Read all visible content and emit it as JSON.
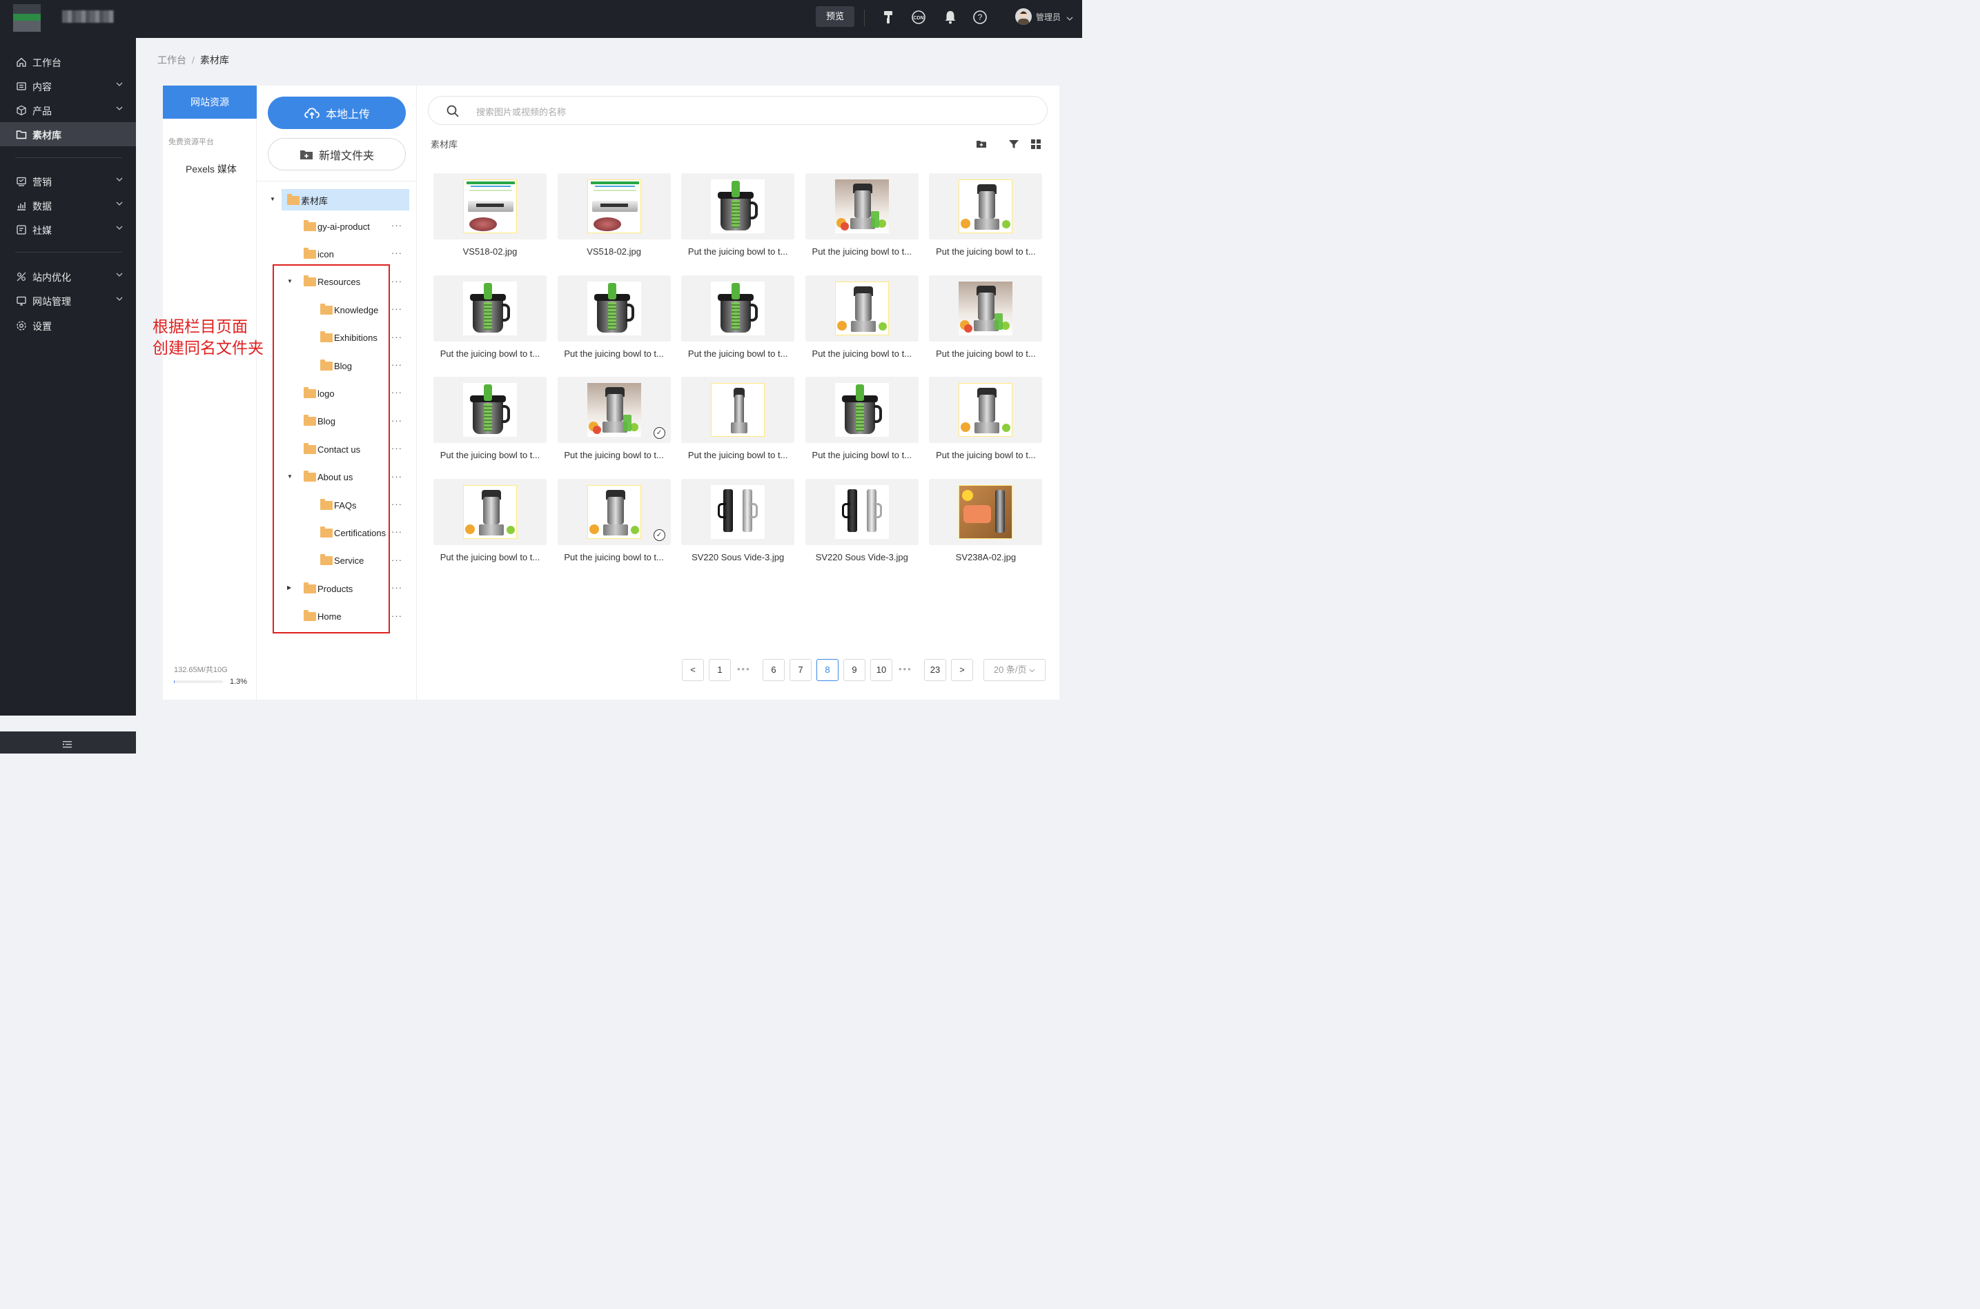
{
  "topbar": {
    "preview_label": "预览",
    "cdn_label": "CDN",
    "user_name": "管理员"
  },
  "sidebar": {
    "items": [
      {
        "label": "工作台",
        "icon": "home-icon",
        "has_children": false,
        "active": false
      },
      {
        "label": "内容",
        "icon": "content-icon",
        "has_children": true,
        "active": false
      },
      {
        "label": "产品",
        "icon": "product-icon",
        "has_children": true,
        "active": false
      },
      {
        "label": "素材库",
        "icon": "folder-icon",
        "has_children": false,
        "active": true
      },
      {
        "label": "营销",
        "icon": "marketing-icon",
        "has_children": true,
        "active": false
      },
      {
        "label": "数据",
        "icon": "data-icon",
        "has_children": true,
        "active": false
      },
      {
        "label": "社媒",
        "icon": "social-icon",
        "has_children": true,
        "active": false
      },
      {
        "label": "站内优化",
        "icon": "seo-icon",
        "has_children": true,
        "active": false
      },
      {
        "label": "网站管理",
        "icon": "website-icon",
        "has_children": true,
        "active": false
      },
      {
        "label": "设置",
        "icon": "settings-icon",
        "has_children": false,
        "active": false
      }
    ]
  },
  "breadcrumb": {
    "parent": "工作台",
    "separator": "/",
    "current": "素材库"
  },
  "sources": {
    "active_tab": "网站资源",
    "free_platform_label": "免费资源平台",
    "pexels_label": "Pexels 媒体",
    "storage_text": "132.65M/共10G",
    "storage_percent_text": "1.3%",
    "storage_fraction": 0.013
  },
  "tree": {
    "upload_label": "本地上传",
    "new_folder_label": "新增文件夹",
    "root_label": "素材库",
    "nodes": [
      {
        "label": "gy-ai-product",
        "level": 1,
        "expander": "none"
      },
      {
        "label": "icon",
        "level": 1,
        "expander": "none"
      },
      {
        "label": "Resources",
        "level": 1,
        "expander": "expanded"
      },
      {
        "label": "Knowledge",
        "level": 2,
        "expander": "none"
      },
      {
        "label": "Exhibitions",
        "level": 2,
        "expander": "none"
      },
      {
        "label": "Blog",
        "level": 2,
        "expander": "none"
      },
      {
        "label": "logo",
        "level": 1,
        "expander": "none"
      },
      {
        "label": "Blog",
        "level": 1,
        "expander": "none"
      },
      {
        "label": "Contact us",
        "level": 1,
        "expander": "none"
      },
      {
        "label": "About us",
        "level": 1,
        "expander": "expanded"
      },
      {
        "label": "FAQs",
        "level": 2,
        "expander": "none"
      },
      {
        "label": "Certifications",
        "level": 2,
        "expander": "none"
      },
      {
        "label": "Service",
        "level": 2,
        "expander": "none"
      },
      {
        "label": "Products",
        "level": 1,
        "expander": "collapsed"
      },
      {
        "label": "Home",
        "level": 1,
        "expander": "none"
      }
    ],
    "more_label": "···"
  },
  "annotation": {
    "line1": "根据栏目页面",
    "line2": "创建同名文件夹",
    "color": "#e02020"
  },
  "assets": {
    "search_placeholder": "搜索图片或视频的名称",
    "title": "素材库",
    "items": [
      {
        "name": "VS518-02.jpg",
        "thumb": "vacuum",
        "checked": false
      },
      {
        "name": "VS518-02.jpg",
        "thumb": "vacuum",
        "checked": false
      },
      {
        "name": "Put the juicing bowl to t...",
        "thumb": "bowl",
        "checked": false
      },
      {
        "name": "Put the juicing bowl to t...",
        "thumb": "juicer-fruit",
        "checked": false
      },
      {
        "name": "Put the juicing bowl to t...",
        "thumb": "juicer-yellow",
        "checked": false
      },
      {
        "name": "Put the juicing bowl to t...",
        "thumb": "bowl",
        "checked": false
      },
      {
        "name": "Put the juicing bowl to t...",
        "thumb": "bowl",
        "checked": false
      },
      {
        "name": "Put the juicing bowl to t...",
        "thumb": "bowl",
        "checked": false
      },
      {
        "name": "Put the juicing bowl to t...",
        "thumb": "juicer-yellow",
        "checked": false
      },
      {
        "name": "Put the juicing bowl to t...",
        "thumb": "juicer-fruit",
        "checked": false
      },
      {
        "name": "Put the juicing bowl to t...",
        "thumb": "bowl",
        "checked": false
      },
      {
        "name": "Put the juicing bowl to t...",
        "thumb": "juicer-fruit",
        "checked": true
      },
      {
        "name": "Put the juicing bowl to t...",
        "thumb": "juicer-plain",
        "checked": false
      },
      {
        "name": "Put the juicing bowl to t...",
        "thumb": "bowl",
        "checked": false
      },
      {
        "name": "Put the juicing bowl to t...",
        "thumb": "juicer-yellow",
        "checked": false
      },
      {
        "name": "Put the juicing bowl to t...",
        "thumb": "juicer-yellow",
        "checked": false
      },
      {
        "name": "Put the juicing bowl to t...",
        "thumb": "juicer-yellow",
        "checked": true
      },
      {
        "name": "SV220 Sous Vide-3.jpg",
        "thumb": "sousvide",
        "checked": false
      },
      {
        "name": "SV220 Sous Vide-3.jpg",
        "thumb": "sousvide",
        "checked": false
      },
      {
        "name": "SV238A-02.jpg",
        "thumb": "salmon",
        "checked": false
      }
    ]
  },
  "pagination": {
    "prev": "<",
    "next": ">",
    "ellipsis": "•••",
    "pages_before": [
      "1"
    ],
    "pages_middle": [
      "6",
      "7",
      "8",
      "9",
      "10"
    ],
    "pages_after": [
      "23"
    ],
    "current_page": "8",
    "page_size_label": "20 条/页"
  },
  "colors": {
    "primary": "#3b87e6",
    "sidebar_bg": "#1f2229",
    "folder": "#f3b866",
    "tree_selected": "#cfe6fb"
  }
}
